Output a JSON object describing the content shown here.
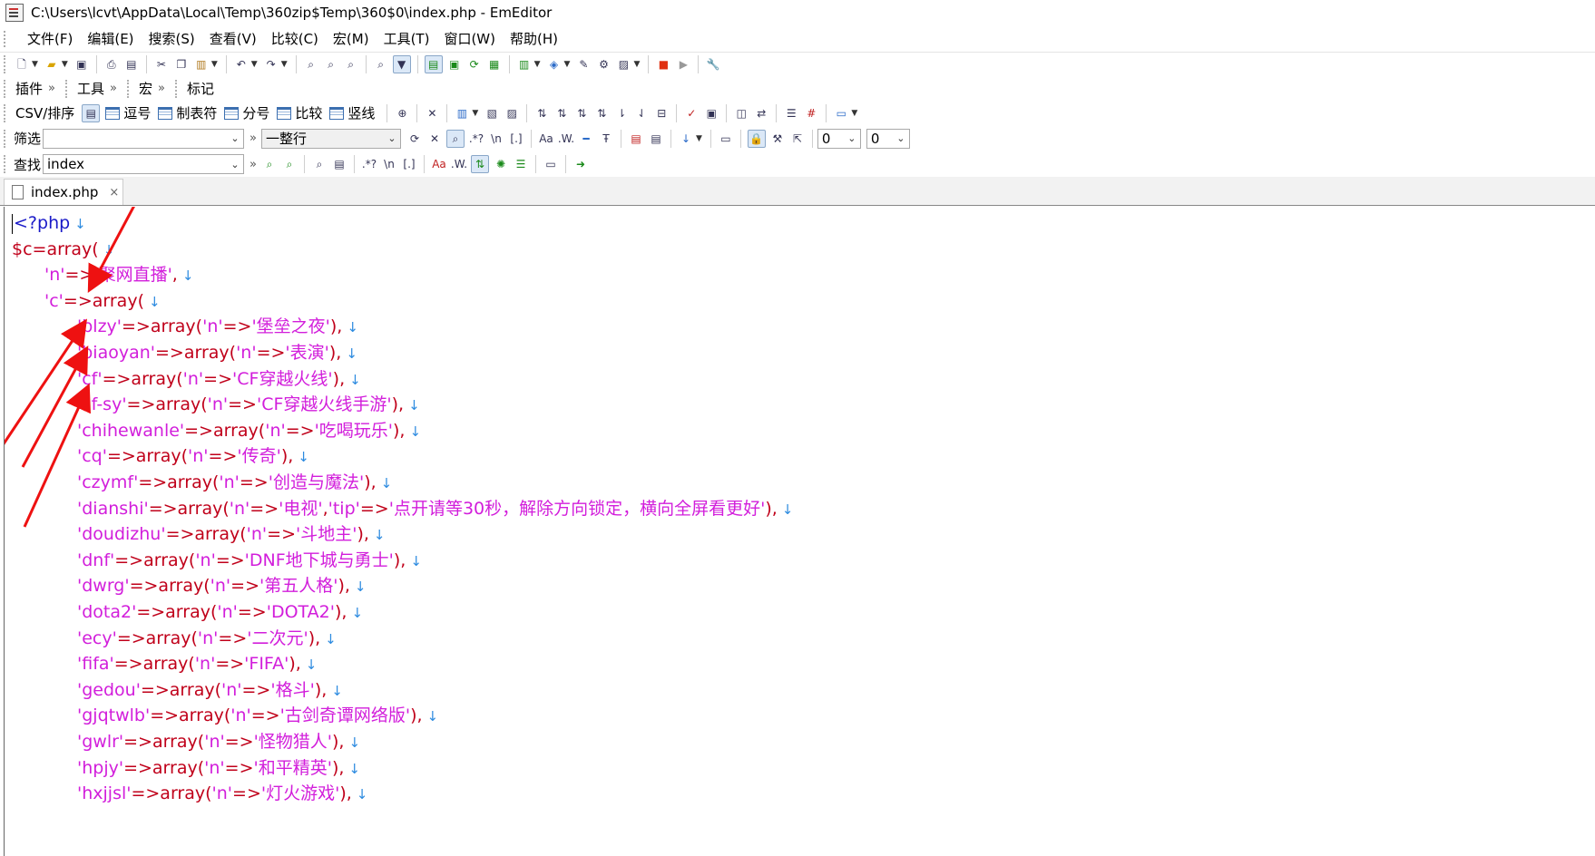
{
  "window": {
    "title": "C:\\Users\\lcvt\\AppData\\Local\\Temp\\360zip$Temp\\360$0\\index.php - EmEditor"
  },
  "menu": [
    "文件(F)",
    "编辑(E)",
    "搜索(S)",
    "查看(V)",
    "比较(C)",
    "宏(M)",
    "工具(T)",
    "窗口(W)",
    "帮助(H)"
  ],
  "toolbar2": {
    "plugins": "插件",
    "tools": "工具",
    "macro": "宏",
    "marker": "标记"
  },
  "csvbar": {
    "label": "CSV/排序",
    "items": [
      "逗号",
      "制表符",
      "分号",
      "比较",
      "竖线"
    ]
  },
  "filterbar": {
    "label": "筛选",
    "input_value": "",
    "mode_value": "一整行",
    "num1": "0",
    "num2": "0"
  },
  "findbar": {
    "label": "查找",
    "input_value": "index"
  },
  "tab": {
    "name": "index.php",
    "close": "×"
  },
  "editor": {
    "eol_mark": "↓",
    "lines": [
      "<?php",
      "$c=array(",
      "'n'=>'聚网直播',",
      "'c'=>array(",
      "'blzy'=>array('n'=>'堡垒之夜'),",
      "'biaoyan'=>array('n'=>'表演'),",
      "'cf'=>array('n'=>'CF穿越火线'),",
      "'cf-sy'=>array('n'=>'CF穿越火线手游'),",
      "'chihewanle'=>array('n'=>'吃喝玩乐'),",
      "'cq'=>array('n'=>'传奇'),",
      "'czymf'=>array('n'=>'创造与魔法'),",
      "'dianshi'=>array('n'=>'电视','tip'=>'点开请等30秒，解除方向锁定，横向全屏看更好'),",
      "'doudizhu'=>array('n'=>'斗地主'),",
      "'dnf'=>array('n'=>'DNF地下城与勇士'),",
      "'dwrg'=>array('n'=>'第五人格'),",
      "'dota2'=>array('n'=>'DOTA2'),",
      "'ecy'=>array('n'=>'二次元'),",
      "'fifa'=>array('n'=>'FIFA'),",
      "'gedou'=>array('n'=>'格斗'),",
      "'gjqtwlb'=>array('n'=>'古剑奇谭网络版'),",
      "'gwlr'=>array('n'=>'怪物猎人'),",
      "'hpjy'=>array('n'=>'和平精英'),",
      "'hxjjsl'=>array('n'=>'灯火游戏'),"
    ]
  },
  "colors": {
    "tag": "#1a1ac8",
    "keyword": "#c0001a",
    "string": "#d21edb",
    "eol": "#2d8be0",
    "annotation_arrow": "#ee1111"
  }
}
